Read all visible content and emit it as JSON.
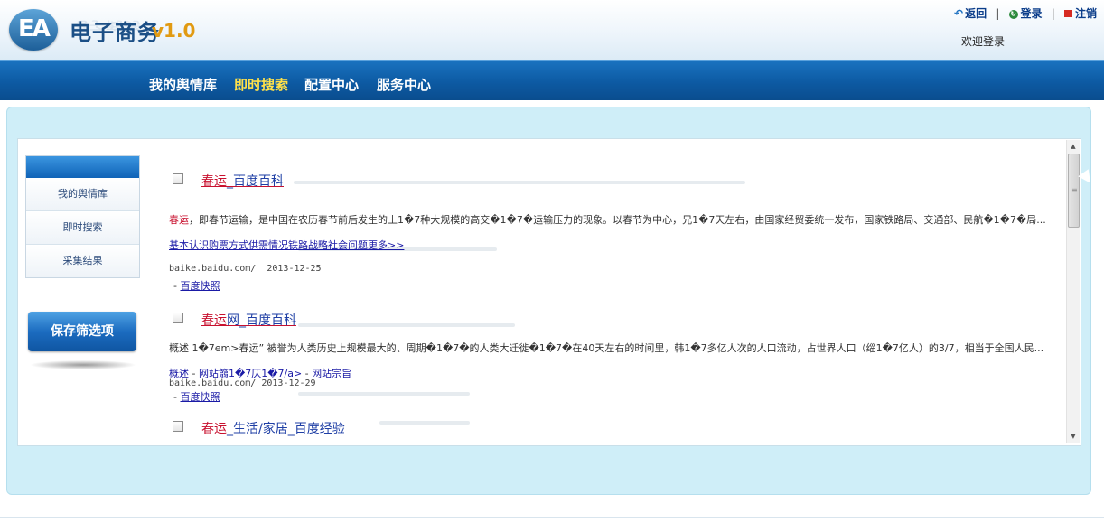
{
  "header": {
    "logo_mark": "EA",
    "app_title": "电子商务",
    "version": "v1.0",
    "links": {
      "back": "返回",
      "login": "登录",
      "logout": "注销"
    },
    "separator": "|",
    "welcome": "欢迎登录"
  },
  "nav": {
    "items": [
      {
        "label": "我的舆情库"
      },
      {
        "label": "即时搜索",
        "active": true
      },
      {
        "label": "配置中心"
      },
      {
        "label": "服务中心"
      }
    ]
  },
  "sidebar": {
    "items": [
      {
        "label": "我的舆情库"
      },
      {
        "label": "即时搜索"
      },
      {
        "label": "采集结果"
      }
    ],
    "save_button": "保存筛选项"
  },
  "results": [
    {
      "title_hl": "春运",
      "title_rest": "_百度百科",
      "snippet_hl": "春运",
      "snippet_rest": "，即春节运输，是中国在农历春节前后发生的丄1�7种大规模的高交�1�7�运输压力的现象。以春节为中心，兄1�7天左右，由国家经贸委统一发布，国家铁路局、交通部、民航�1�7�局...",
      "extra_link": "基本认识购票方式供需情况铁路战略社会问题更多>>",
      "url": "baike.baidu.com/",
      "date": "2013-12-25",
      "dash": "-",
      "snapshot": "百度快照"
    },
    {
      "title_hl": "春运",
      "title_rest": "网_百度百科",
      "snippet_hl": "",
      "snippet_rest": "概述 1�7em>春运” 被誉为人类历史上规模最大的、周期�1�7�的人类大迁徙�1�7�在40天左右的时间里，韩1�7多亿人次的人口流动，占世界人口（缁1�7亿人）的3/7，相当于全国人民...",
      "link_a": "概述",
      "link_sep": " - ",
      "link_b": "网站篛1�7仄1�7/a>",
      "link_c": "网站宗旨",
      "url": "baike.baidu.com/",
      "date": "2013-12-29",
      "dash": "-",
      "snapshot": "百度快照"
    },
    {
      "title_hl": "春运",
      "title_rest": "_生活/家居_百度经验"
    }
  ],
  "scrollbar": {
    "up": "▲",
    "down": "▼",
    "grip": "≡"
  }
}
